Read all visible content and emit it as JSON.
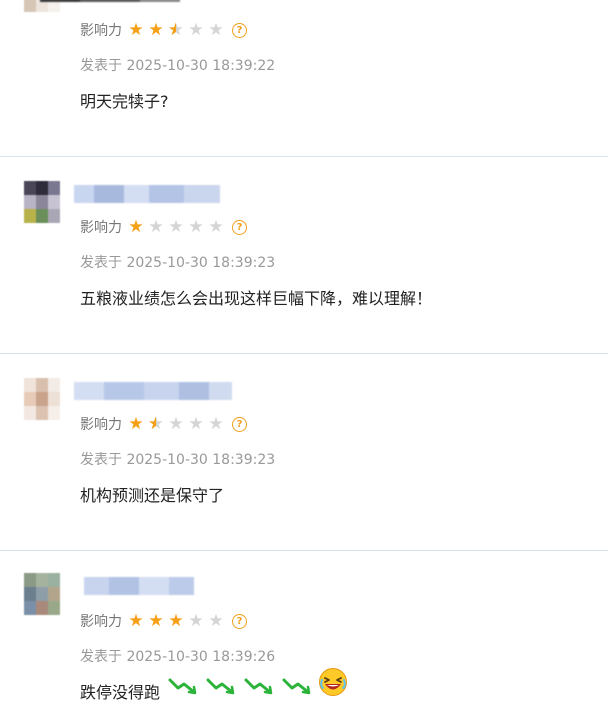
{
  "comments": [
    {
      "influence_label": "影响力",
      "rating": 2.5,
      "posted_at": "发表于 2025-10-30 18:39:22",
      "text": "明天完犊子?"
    },
    {
      "influence_label": "影响力",
      "rating": 1,
      "posted_at": "发表于 2025-10-30 18:39:23",
      "text": "五粮液业绩怎么会出现这样巨幅下降，难以理解！"
    },
    {
      "influence_label": "影响力",
      "rating": 1.5,
      "posted_at": "发表于 2025-10-30 18:39:23",
      "text": "机构预测还是保守了"
    },
    {
      "influence_label": "影响力",
      "rating": 3,
      "posted_at": "发表于 2025-10-30 18:39:26",
      "text": "跌停没得跑",
      "emojis": [
        "falling-arrow-icon",
        "falling-arrow-icon",
        "falling-arrow-icon",
        "falling-arrow-icon",
        "laughing-face-icon"
      ]
    }
  ],
  "colors": {
    "star_full": "#f5a016",
    "star_empty": "#d5d5d5",
    "divider": "#dbe3ef",
    "fall_green": "#2bb33a"
  }
}
